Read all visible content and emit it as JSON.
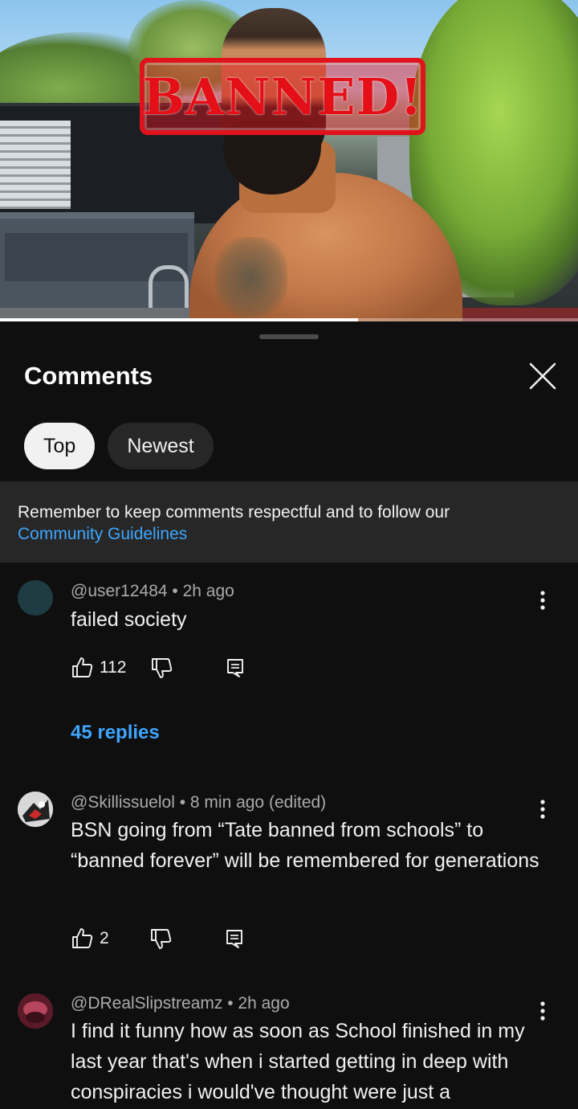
{
  "video": {
    "overlay_text": "BANNED!",
    "progress": 0.62
  },
  "sheet": {
    "title": "Comments",
    "close_icon": "close-icon",
    "sort_chips": [
      {
        "label": "Top",
        "active": true
      },
      {
        "label": "Newest",
        "active": false
      }
    ],
    "notice": {
      "text": "Remember to keep comments respectful and to follow our",
      "link": "Community Guidelines"
    }
  },
  "comments": [
    {
      "handle": "@user12484",
      "time": "2h ago",
      "edited": "",
      "text": "failed society",
      "likes": "112",
      "replies": "45 replies",
      "avatar_color": "#1e3c42"
    },
    {
      "handle": "@Skillissuelol",
      "time": "8 min ago",
      "edited": "(edited)",
      "text": "BSN going from “Tate banned from schools” to “banned forever” will be remembered for generations",
      "likes": "2",
      "replies": "",
      "avatar_color": "#e8e8e8"
    },
    {
      "handle": "@DRealSlipstreamz",
      "time": "2h ago",
      "edited": "",
      "text": "I find it funny how as soon as School finished in my last year that's when i started getting in deep with conspiracies i would've thought were just a",
      "likes": "",
      "replies": "",
      "avatar_color": "#7a2436"
    }
  ],
  "colors": {
    "background": "#0f0f0f",
    "accent_link": "#3ea6ff",
    "banned_red": "#e40f17"
  }
}
